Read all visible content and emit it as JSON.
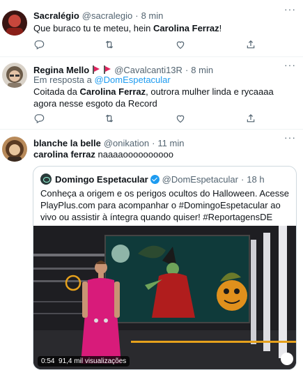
{
  "tweets": [
    {
      "name": "Sacralégio",
      "handle": "@sacralegio",
      "time": "8 min",
      "text_prefix": "Que buraco tu te meteu, hein ",
      "text_bold": "Carolina Ferraz",
      "text_suffix": "!"
    },
    {
      "name": "Regina Mello",
      "handle": "@Cavalcanti13R",
      "time": "8 min",
      "reply_prefix": "Em resposta a ",
      "reply_to": "@DomEspetacular",
      "text_prefix": "Coitada da ",
      "text_bold": "Carolina Ferraz",
      "text_suffix": ", outrora mulher linda e rycaaaa agora nesse esgoto da Record"
    },
    {
      "name": "blanche la belle",
      "handle": "@onikation",
      "time": "11 min",
      "text_bold": "carolina ferraz",
      "text_suffix": " naaaaoooooooooo"
    }
  ],
  "quote": {
    "name": "Domingo Espetacular",
    "handle": "@DomEspetacular",
    "time": "18 h",
    "text": "Conheça a origem e os perigos ocultos do Halloween. Acesse PlayPlus.com para acompanhar o #DomingoEspetacular ao vivo ou assistir à íntegra quando quiser! #ReportagensDE",
    "video_duration": "0:54",
    "video_views": "91,4 mil visualizações"
  },
  "separator": "·",
  "more_label": "···",
  "icons": [
    "reply-icon",
    "retweet-icon",
    "like-icon",
    "share-icon",
    "more-icon",
    "verified-icon",
    "flag-icon"
  ],
  "colors": {
    "link": "#1d9bf0",
    "secondary": "#536471",
    "text": "#0f1419",
    "flag": "#e0245e",
    "dress": "#d81b7a"
  }
}
